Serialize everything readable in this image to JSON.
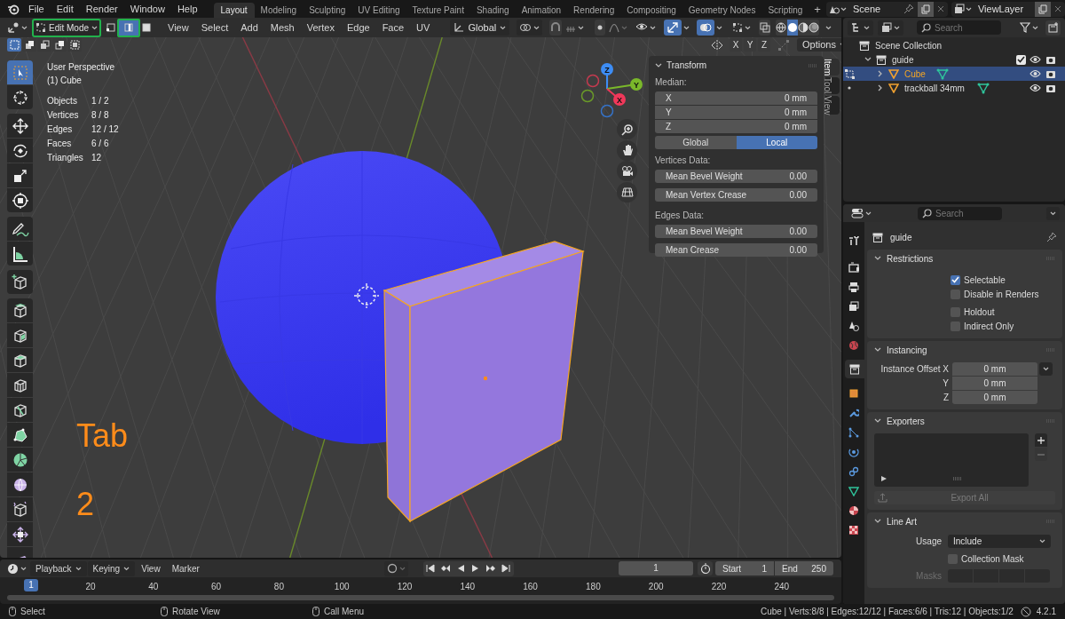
{
  "menu_bar": [
    "File",
    "Edit",
    "Render",
    "Window",
    "Help"
  ],
  "workspaces": {
    "tabs": [
      {
        "label": "Layout",
        "selected": true
      },
      {
        "label": "Modeling",
        "selected": false
      },
      {
        "label": "Sculpting",
        "selected": false
      },
      {
        "label": "UV Editing",
        "selected": false
      },
      {
        "label": "Texture Paint",
        "selected": false
      },
      {
        "label": "Shading",
        "selected": false
      },
      {
        "label": "Animation",
        "selected": false
      },
      {
        "label": "Rendering",
        "selected": false
      },
      {
        "label": "Compositing",
        "selected": false
      },
      {
        "label": "Geometry Nodes",
        "selected": false
      },
      {
        "label": "Scripting",
        "selected": false
      }
    ],
    "add": "+"
  },
  "scene": {
    "name": "Scene"
  },
  "view_layer": {
    "name": "ViewLayer"
  },
  "viewport_header": {
    "mode": {
      "label": "Edit Mode",
      "highlighted": true
    },
    "select_modes": [
      {
        "kind": "vertex",
        "selected": false,
        "highlighted": false
      },
      {
        "kind": "edge",
        "selected": true,
        "highlighted": true
      },
      {
        "kind": "face",
        "selected": false,
        "highlighted": false
      }
    ],
    "menus": [
      "View",
      "Select",
      "Add",
      "Mesh",
      "Vertex",
      "Edge",
      "Face",
      "UV"
    ],
    "orientation": "Global",
    "gizmos_on": true,
    "overlays_on": true,
    "shading": [
      {
        "kind": "wireframe",
        "selected": false
      },
      {
        "kind": "solid",
        "selected": true
      },
      {
        "kind": "material",
        "selected": false
      },
      {
        "kind": "rendered",
        "selected": false
      }
    ],
    "selection_ops": [
      {
        "selected": true
      },
      {
        "selected": false
      },
      {
        "selected": false
      },
      {
        "selected": false
      },
      {
        "selected": false
      }
    ],
    "mirror_axes": [
      {
        "label": "X",
        "selected": false
      },
      {
        "label": "Y",
        "selected": false
      },
      {
        "label": "Z",
        "selected": false
      }
    ],
    "options": "Options"
  },
  "viewport": {
    "view_name": "User Perspective",
    "object_name": "(1) Cube",
    "stats": [
      {
        "label": "Objects",
        "value": "1 / 2"
      },
      {
        "label": "Vertices",
        "value": "8 / 8"
      },
      {
        "label": "Edges",
        "value": "12 / 12"
      },
      {
        "label": "Faces",
        "value": "6 / 6"
      },
      {
        "label": "Triangles",
        "value": "12"
      }
    ],
    "annotations": [
      "Tab",
      "2"
    ],
    "gizmo_axes": [
      "Z",
      "Y",
      "X"
    ],
    "toolbar": [
      {
        "kind": "select_box",
        "selected": true
      },
      {
        "kind": "cursor",
        "selected": false
      },
      {
        "kind": "move",
        "selected": false
      },
      {
        "kind": "rotate",
        "selected": false
      },
      {
        "kind": "scale",
        "selected": false
      },
      {
        "kind": "transform",
        "selected": false
      },
      {
        "kind": "annotate",
        "selected": false
      },
      {
        "kind": "measure",
        "selected": false
      },
      {
        "kind": "add_cube",
        "selected": false
      },
      {
        "kind": "extrude",
        "selected": false
      },
      {
        "kind": "inset",
        "selected": false
      },
      {
        "kind": "bevel",
        "selected": false
      },
      {
        "kind": "loop_cut",
        "selected": false
      },
      {
        "kind": "knife",
        "selected": false
      },
      {
        "kind": "poly_build",
        "selected": false
      },
      {
        "kind": "spin",
        "selected": false
      },
      {
        "kind": "smooth",
        "selected": false
      },
      {
        "kind": "edge_slide",
        "selected": false
      },
      {
        "kind": "shrink",
        "selected": false
      },
      {
        "kind": "shear",
        "selected": false
      }
    ]
  },
  "sidebar": {
    "tabs": [
      {
        "label": "Item",
        "selected": true
      },
      {
        "label": "Tool",
        "selected": false
      },
      {
        "label": "View",
        "selected": false
      }
    ],
    "panel": {
      "title": "Transform",
      "expanded": true,
      "median_label": "Median:",
      "median": [
        {
          "label": "X",
          "value": "0 mm"
        },
        {
          "label": "Y",
          "value": "0 mm"
        },
        {
          "label": "Z",
          "value": "0 mm"
        }
      ],
      "space": [
        {
          "label": "Global",
          "selected": false
        },
        {
          "label": "Local",
          "selected": true
        }
      ],
      "vertices_label": "Vertices Data:",
      "vertices": [
        {
          "label": "Mean Bevel Weight",
          "value": "0.00"
        },
        {
          "label": "Mean Vertex Crease",
          "value": "0.00"
        }
      ],
      "edges_label": "Edges Data:",
      "edges": [
        {
          "label": "Mean Bevel Weight",
          "value": "0.00"
        },
        {
          "label": "Mean Crease",
          "value": "0.00"
        }
      ]
    }
  },
  "outliner": {
    "search_placeholder": "Search",
    "tree": [
      {
        "name": "Scene Collection",
        "kind": "scene",
        "children": [
          {
            "name": "guide",
            "kind": "collection",
            "expanded": true,
            "checked": true,
            "children": [
              {
                "name": "Cube",
                "kind": "object",
                "expanded": false,
                "selected": true,
                "in_edit_mode": true
              },
              {
                "name": "trackball 34mm",
                "kind": "object",
                "expanded": false,
                "selected": false,
                "in_edit_mode": false
              }
            ]
          }
        ]
      }
    ]
  },
  "properties": {
    "search_placeholder": "Search",
    "tabs": [
      {
        "kind": "tool",
        "selected": false
      },
      {
        "kind": "render",
        "selected": false
      },
      {
        "kind": "output",
        "selected": false
      },
      {
        "kind": "view_layer",
        "selected": false
      },
      {
        "kind": "scene",
        "selected": false
      },
      {
        "kind": "world",
        "selected": false
      },
      {
        "kind": "collection",
        "selected": true
      },
      {
        "kind": "object",
        "selected": false
      },
      {
        "kind": "modifiers",
        "selected": false
      },
      {
        "kind": "particles",
        "selected": false
      },
      {
        "kind": "physics",
        "selected": false
      },
      {
        "kind": "constraints",
        "selected": false
      },
      {
        "kind": "data",
        "selected": false
      },
      {
        "kind": "material",
        "selected": false
      },
      {
        "kind": "texture",
        "selected": false
      }
    ],
    "context": "guide",
    "panels": [
      {
        "kind": "restrictions",
        "title": "Restrictions",
        "expanded": true,
        "check_groups": [
          [
            {
              "label": "Selectable",
              "checked": true
            },
            {
              "label": "Disable in Renders",
              "checked": false
            }
          ],
          [
            {
              "label": "Holdout",
              "checked": false
            },
            {
              "label": "Indirect Only",
              "checked": false
            }
          ]
        ]
      },
      {
        "kind": "instancing",
        "title": "Instancing",
        "expanded": true,
        "rows": [
          {
            "label": "Instance Offset X",
            "value": "0 mm"
          },
          {
            "label": "Y",
            "value": "0 mm"
          },
          {
            "label": "Z",
            "value": "0 mm"
          }
        ]
      },
      {
        "kind": "exporters",
        "title": "Exporters",
        "expanded": true,
        "button": {
          "label": "Export All",
          "disabled": true
        }
      },
      {
        "kind": "line_art",
        "title": "Line Art",
        "expanded": true,
        "usage_label": "Usage",
        "usage": "Include",
        "checks": [
          {
            "label": "Collection Mask",
            "checked": false
          }
        ],
        "masks_label": "Masks",
        "masks_disabled": true
      }
    ]
  },
  "timeline": {
    "menus": [
      {
        "label": "Playback",
        "dropdown": true
      },
      {
        "label": "Keying",
        "dropdown": true
      },
      {
        "label": "View",
        "dropdown": false
      },
      {
        "label": "Marker",
        "dropdown": false
      }
    ],
    "current_frame": "1",
    "start_label": "Start",
    "start": "1",
    "end_label": "End",
    "end": "250",
    "playhead": "1",
    "ticks": [
      "20",
      "40",
      "60",
      "80",
      "100",
      "120",
      "140",
      "160",
      "180",
      "200",
      "220",
      "240"
    ]
  },
  "status_bar": {
    "hints": [
      "Select",
      "Rotate View",
      "Call Menu"
    ],
    "stats": "Cube | Verts:8/8 | Edges:12/12 | Faces:6/6 | Tris:12 | Objects:1/2",
    "version": "4.2.1"
  }
}
